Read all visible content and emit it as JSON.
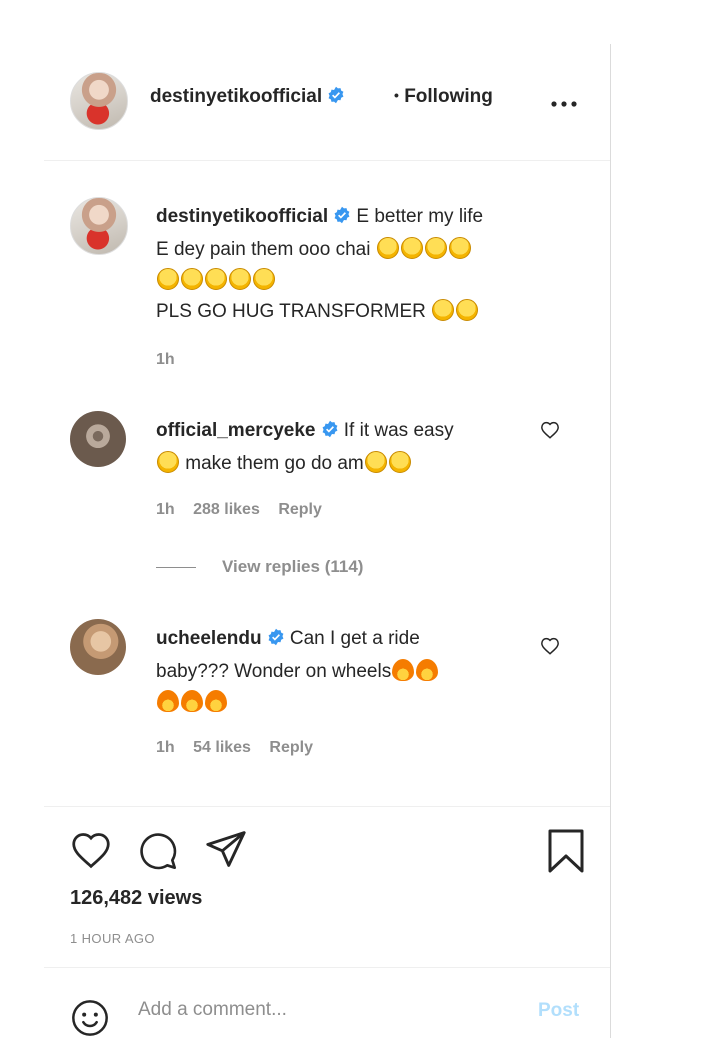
{
  "header": {
    "username": "destinyetikoofficial",
    "separator": "•",
    "follow_status": "Following",
    "more": "•••"
  },
  "caption": {
    "username": "destinyetikoofficial",
    "text_line1": "E better my life",
    "text_line2": "E dey pain them ooo chai",
    "text_line3": "PLS GO HUG TRANSFORMER",
    "time": "1h"
  },
  "comments": [
    {
      "username": "official_mercyeke",
      "text_a": "If it was easy",
      "text_b": "make them go do am",
      "time": "1h",
      "likes": "288 likes",
      "reply": "Reply",
      "view_replies": "View replies (114)"
    },
    {
      "username": "ucheelendu",
      "text_a": "Can I get a ride",
      "text_b": "baby??? Wonder on wheels",
      "time": "1h",
      "likes": "54 likes",
      "reply": "Reply"
    }
  ],
  "footer": {
    "views": "126,482 views",
    "posted": "1 HOUR AGO",
    "comment_placeholder": "Add a comment...",
    "post_label": "Post"
  },
  "colors": {
    "verified": "#3897f0",
    "muted": "#8e8e8e",
    "post_disabled": "#b2dffc"
  }
}
